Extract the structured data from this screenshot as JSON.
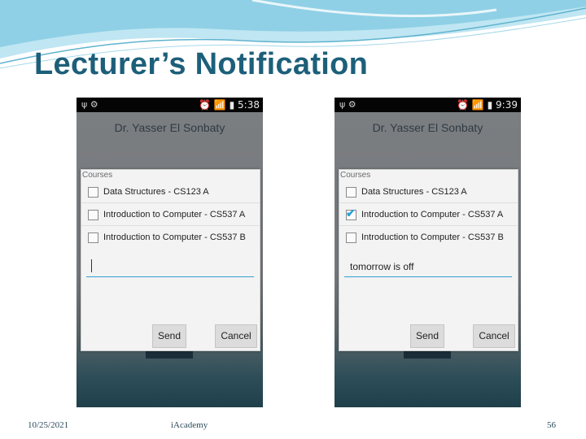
{
  "slide": {
    "title": "Lecturer’s Notification",
    "footer": {
      "date": "10/25/2021",
      "center": "iAcademy",
      "page": "56"
    }
  },
  "colors": {
    "title": "#1d5f7a",
    "accent": "#33a0d0",
    "checkmark": "#2a9fd6"
  },
  "phones": [
    {
      "status": {
        "icons_left": "ψ ⚙",
        "icons_right": "⏰ 📶 ▮",
        "time": "5:38"
      },
      "app_title": "Dr. Yasser El Sonbaty",
      "dialog": {
        "title": "Courses",
        "courses": [
          {
            "label": "Data Structures - CS123 A",
            "checked": false
          },
          {
            "label": "Introduction to Computer - CS537 A",
            "checked": false
          },
          {
            "label": "Introduction to Computer - CS537 B",
            "checked": false
          }
        ],
        "message": "",
        "send_label": "Send",
        "cancel_label": "Cancel"
      }
    },
    {
      "status": {
        "icons_left": "ψ ⚙",
        "icons_right": "⏰ 📶 ▮",
        "time": "9:39"
      },
      "app_title": "Dr. Yasser El Sonbaty",
      "dialog": {
        "title": "Courses",
        "courses": [
          {
            "label": "Data Structures - CS123 A",
            "checked": false
          },
          {
            "label": "Introduction to Computer - CS537 A",
            "checked": true
          },
          {
            "label": "Introduction to Computer - CS537 B",
            "checked": false
          }
        ],
        "message": "tomorrow is off",
        "send_label": "Send",
        "cancel_label": "Cancel"
      }
    }
  ]
}
